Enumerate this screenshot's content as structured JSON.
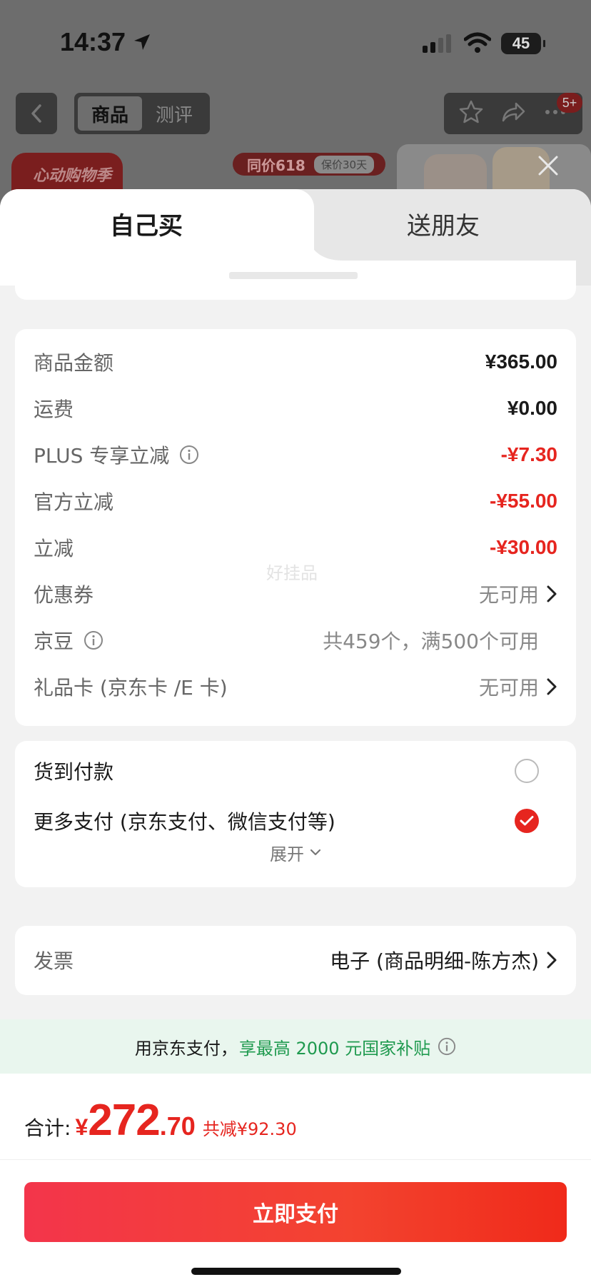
{
  "status_bar": {
    "time": "14:37",
    "battery": "45"
  },
  "background_page": {
    "tabs": [
      "商品",
      "测评"
    ],
    "active_tab": "商品",
    "badge": "5+",
    "promo_banner": "心动购物季",
    "price_tag_main": "同价618",
    "price_tag_sub": "保价30天"
  },
  "sheet": {
    "tabs": {
      "self": "自己买",
      "friend": "送朋友"
    },
    "watermark": "好挂品",
    "fees": {
      "goods_amount": {
        "label": "商品金额",
        "value": "¥365.00"
      },
      "shipping": {
        "label": "运费",
        "value": "¥0.00"
      },
      "plus_discount": {
        "label": "PLUS 专享立减",
        "value": "-¥7.30"
      },
      "official_discount": {
        "label": "官方立减",
        "value": "-¥55.00"
      },
      "discount": {
        "label": "立减",
        "value": "-¥30.00"
      },
      "coupon": {
        "label": "优惠券",
        "value": "无可用"
      },
      "jingdou": {
        "label": "京豆",
        "value": "共459个，满500个可用"
      },
      "gift_card": {
        "label": "礼品卡 (京东卡 /E 卡)",
        "value": "无可用"
      }
    },
    "payment": {
      "cod": {
        "label": "货到付款",
        "selected": false
      },
      "more": {
        "label": "更多支付 (京东支付、微信支付等)",
        "selected": true
      },
      "expand_label": "展开"
    },
    "invoice": {
      "label": "发票",
      "value": "电子 (商品明细-陈方杰)"
    },
    "subsidy": {
      "prefix": "用京东支付，",
      "highlight": "享最高 2000 元国家补贴"
    },
    "footer": {
      "total_label": "合计:",
      "currency": "¥",
      "total_int": "272",
      "total_dec": ".70",
      "saved": "共减¥92.30",
      "pay_button": "立即支付"
    }
  },
  "colors": {
    "accent_red": "#e6251f",
    "subsidy_green": "#1f9a4f",
    "subsidy_bg": "#e9f6ee"
  }
}
